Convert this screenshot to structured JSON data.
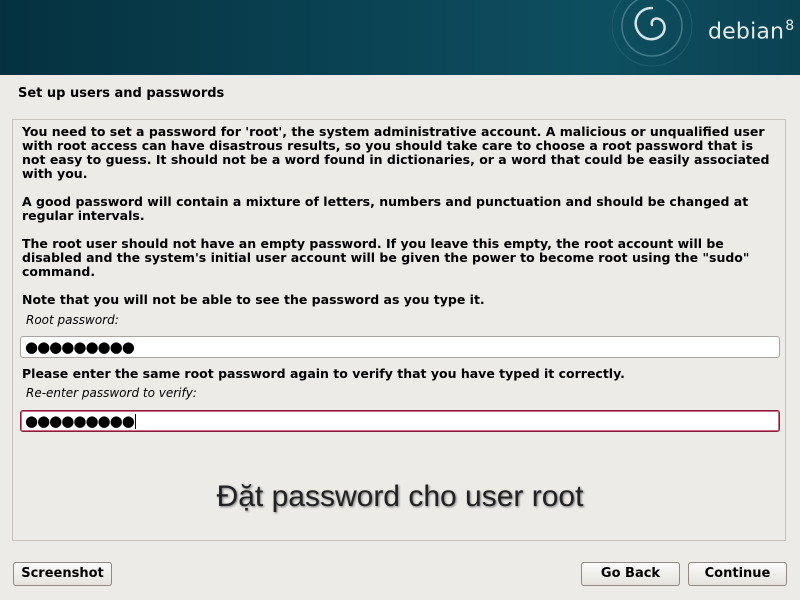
{
  "branding": {
    "logo_text": "debian",
    "logo_version": "8",
    "banner_color": "#0a4354"
  },
  "page": {
    "title": "Set up users and passwords"
  },
  "content": {
    "paragraph_1": "You need to set a password for 'root', the system administrative account. A malicious or unqualified user with root access can have disastrous results, so you should take care to choose a root password that is not easy to guess. It should not be a word found in dictionaries, or a word that could be easily associated with you.",
    "paragraph_2": "A good password will contain a mixture of letters, numbers and punctuation and should be changed at regular intervals.",
    "paragraph_3": "The root user should not have an empty password. If you leave this empty, the root account will be disabled and the system's initial user account will be given the power to become root using the \"sudo\" command.",
    "paragraph_4": "Note that you will not be able to see the password as you type it.",
    "root_password_label": "Root password:",
    "root_password_value": "●●●●●●●●●",
    "verify_instruction": "Please enter the same root password again to verify that you have typed it correctly.",
    "verify_label": "Re-enter password to verify:",
    "verify_password_value": "●●●●●●●●●",
    "overlay_caption": "Đặt password cho user root"
  },
  "buttons": {
    "screenshot": "Screenshot",
    "go_back": "Go Back",
    "continue": "Continue"
  },
  "colors": {
    "focus_border": "#8e1a3c",
    "background": "#edebe7"
  }
}
